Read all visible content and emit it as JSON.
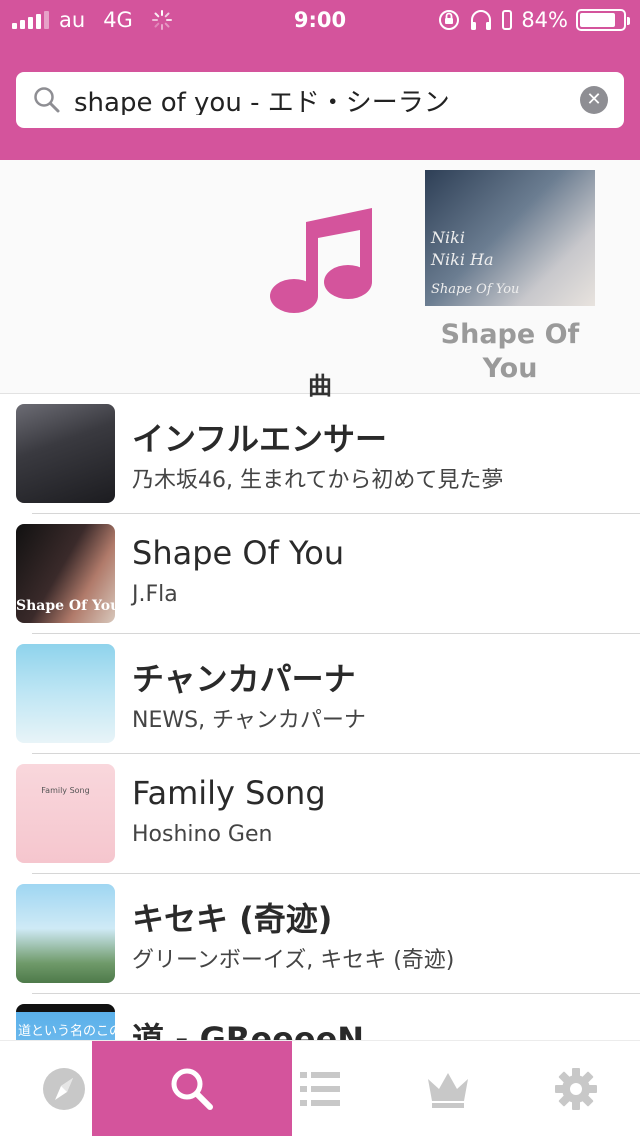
{
  "status_bar": {
    "carrier": "au",
    "network": "4G",
    "time": "9:00",
    "battery": "84%",
    "battery_level": 0.84
  },
  "search": {
    "value": "shape of you - エド・シーラン",
    "placeholder": ""
  },
  "categories": [
    {
      "label": "曲",
      "icon": "music-note-icon"
    },
    {
      "label_line1": "Shape Of",
      "label_line2": "You",
      "art_text": [
        "Niki",
        "Niki Ha",
        "Shape Of You"
      ]
    }
  ],
  "results": [
    {
      "title": "インフルエンサー",
      "subtitle": "乃木坂46, 生まれてから初めて見た夢"
    },
    {
      "title": "Shape Of You",
      "subtitle": "J.Fla",
      "art_text": "Shape Of You"
    },
    {
      "title": "チャンカパーナ",
      "subtitle": "NEWS, チャンカパーナ"
    },
    {
      "title": "Family Song",
      "subtitle": "Hoshino Gen",
      "art_text": "Family Song"
    },
    {
      "title": "キセキ (奇迹)",
      "subtitle": "グリーンボーイズ, キセキ (奇迹)"
    },
    {
      "title": "道 - GReeeeN",
      "subtitle": "",
      "art_text": "道という名のこの"
    }
  ],
  "tabs": [
    {
      "name": "discover",
      "icon": "compass-icon",
      "active": false
    },
    {
      "name": "search",
      "icon": "search-icon",
      "active": true
    },
    {
      "name": "playlists",
      "icon": "list-icon",
      "active": false
    },
    {
      "name": "ranking",
      "icon": "crown-icon",
      "active": false
    },
    {
      "name": "settings",
      "icon": "gear-icon",
      "active": false
    }
  ],
  "colors": {
    "accent": "#d4549c",
    "inactive_icon": "#c8c8c8"
  }
}
